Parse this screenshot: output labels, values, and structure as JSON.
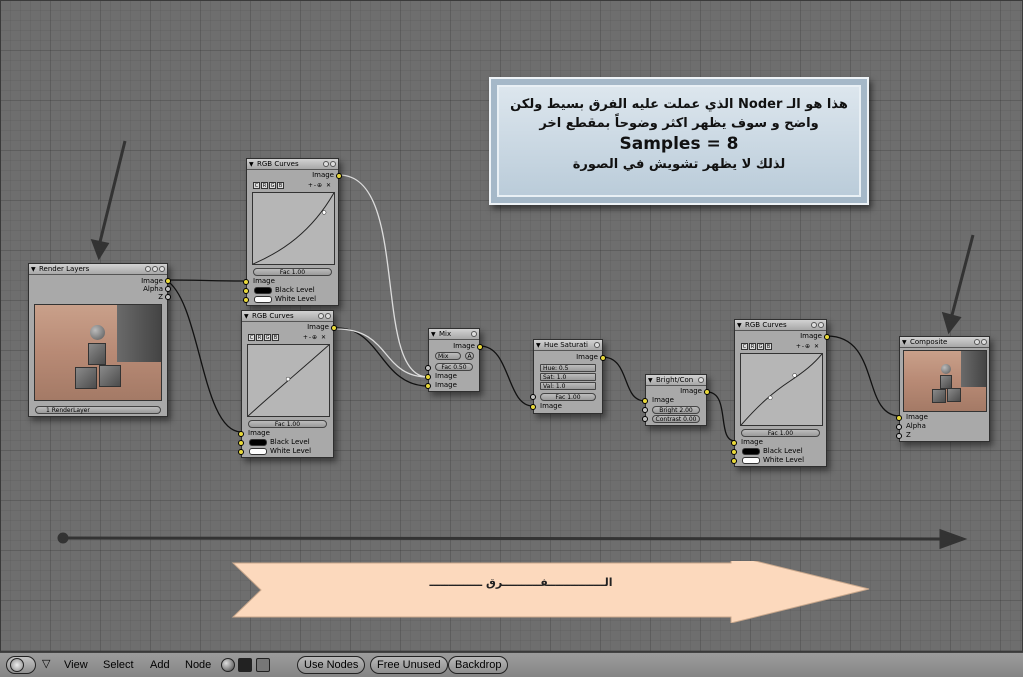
{
  "note": {
    "line1": "هذا هو الـ Noder الذي عملت عليه الفرق بسيط ولكن",
    "line2": "واضح و سوف يظهر اكثر وضوحاً بمقطع اخر",
    "line3": "Samples = 8",
    "line4": "لذلك لا يظهر تشويش في الصورة"
  },
  "big_arrow": {
    "label": "الـــــــــــــــفــــــــــرق ــــــــــــــ"
  },
  "nodes": {
    "render_layers": {
      "title": "Render Layers",
      "outputs": [
        "Image",
        "Alpha",
        "Z"
      ],
      "layer_select": "1 RenderLayer"
    },
    "rgb_curves_1": {
      "title": "RGB Curves",
      "output": "Image",
      "tabs": [
        "C",
        "R",
        "G",
        "B"
      ],
      "fac": "Fac 1.00",
      "inputs": [
        "Image",
        "Black Level",
        "White Level"
      ]
    },
    "rgb_curves_2": {
      "title": "RGB Curves",
      "output": "Image",
      "tabs": [
        "C",
        "R",
        "G",
        "B"
      ],
      "fac": "Fac 1.00",
      "inputs": [
        "Image",
        "Black Level",
        "White Level"
      ]
    },
    "mix": {
      "title": "Mix",
      "output": "Image",
      "mode": "Mix",
      "alpha_btn": "A",
      "fac": "Fac 0.50",
      "inputs": [
        "Image",
        "Image"
      ]
    },
    "hue_sat": {
      "title": "Hue Saturati",
      "output": "Image",
      "hue": "Hue: 0.5",
      "sat": "Sat: 1.0",
      "val": "Val: 1.0",
      "fac": "Fac 1.00",
      "input": "Image"
    },
    "bright_con": {
      "title": "Bright/Con",
      "output": "Image",
      "input": "Image",
      "bright": "Bright 2.00",
      "contrast": "Contrast 0.00"
    },
    "rgb_curves_3": {
      "title": "RGB Curves",
      "output": "Image",
      "tabs": [
        "C",
        "R",
        "G",
        "B"
      ],
      "fac": "Fac 1.00",
      "inputs": [
        "Image",
        "Black Level",
        "White Level"
      ]
    },
    "composite": {
      "title": "Composite",
      "inputs": [
        "Image",
        "Alpha",
        "Z"
      ]
    }
  },
  "bottombar": {
    "menu_view": "View",
    "menu_select": "Select",
    "menu_add": "Add",
    "menu_node": "Node",
    "use_nodes": "Use Nodes",
    "free_unused": "Free Unused",
    "backdrop": "Backdrop"
  },
  "colors": {
    "socket_image": "#e8d83b",
    "socket_value": "#c0c0c0",
    "background": "#6e6e6e",
    "note_bg": "#c9d7e3",
    "arrow_fill": "#fcd9bd"
  }
}
